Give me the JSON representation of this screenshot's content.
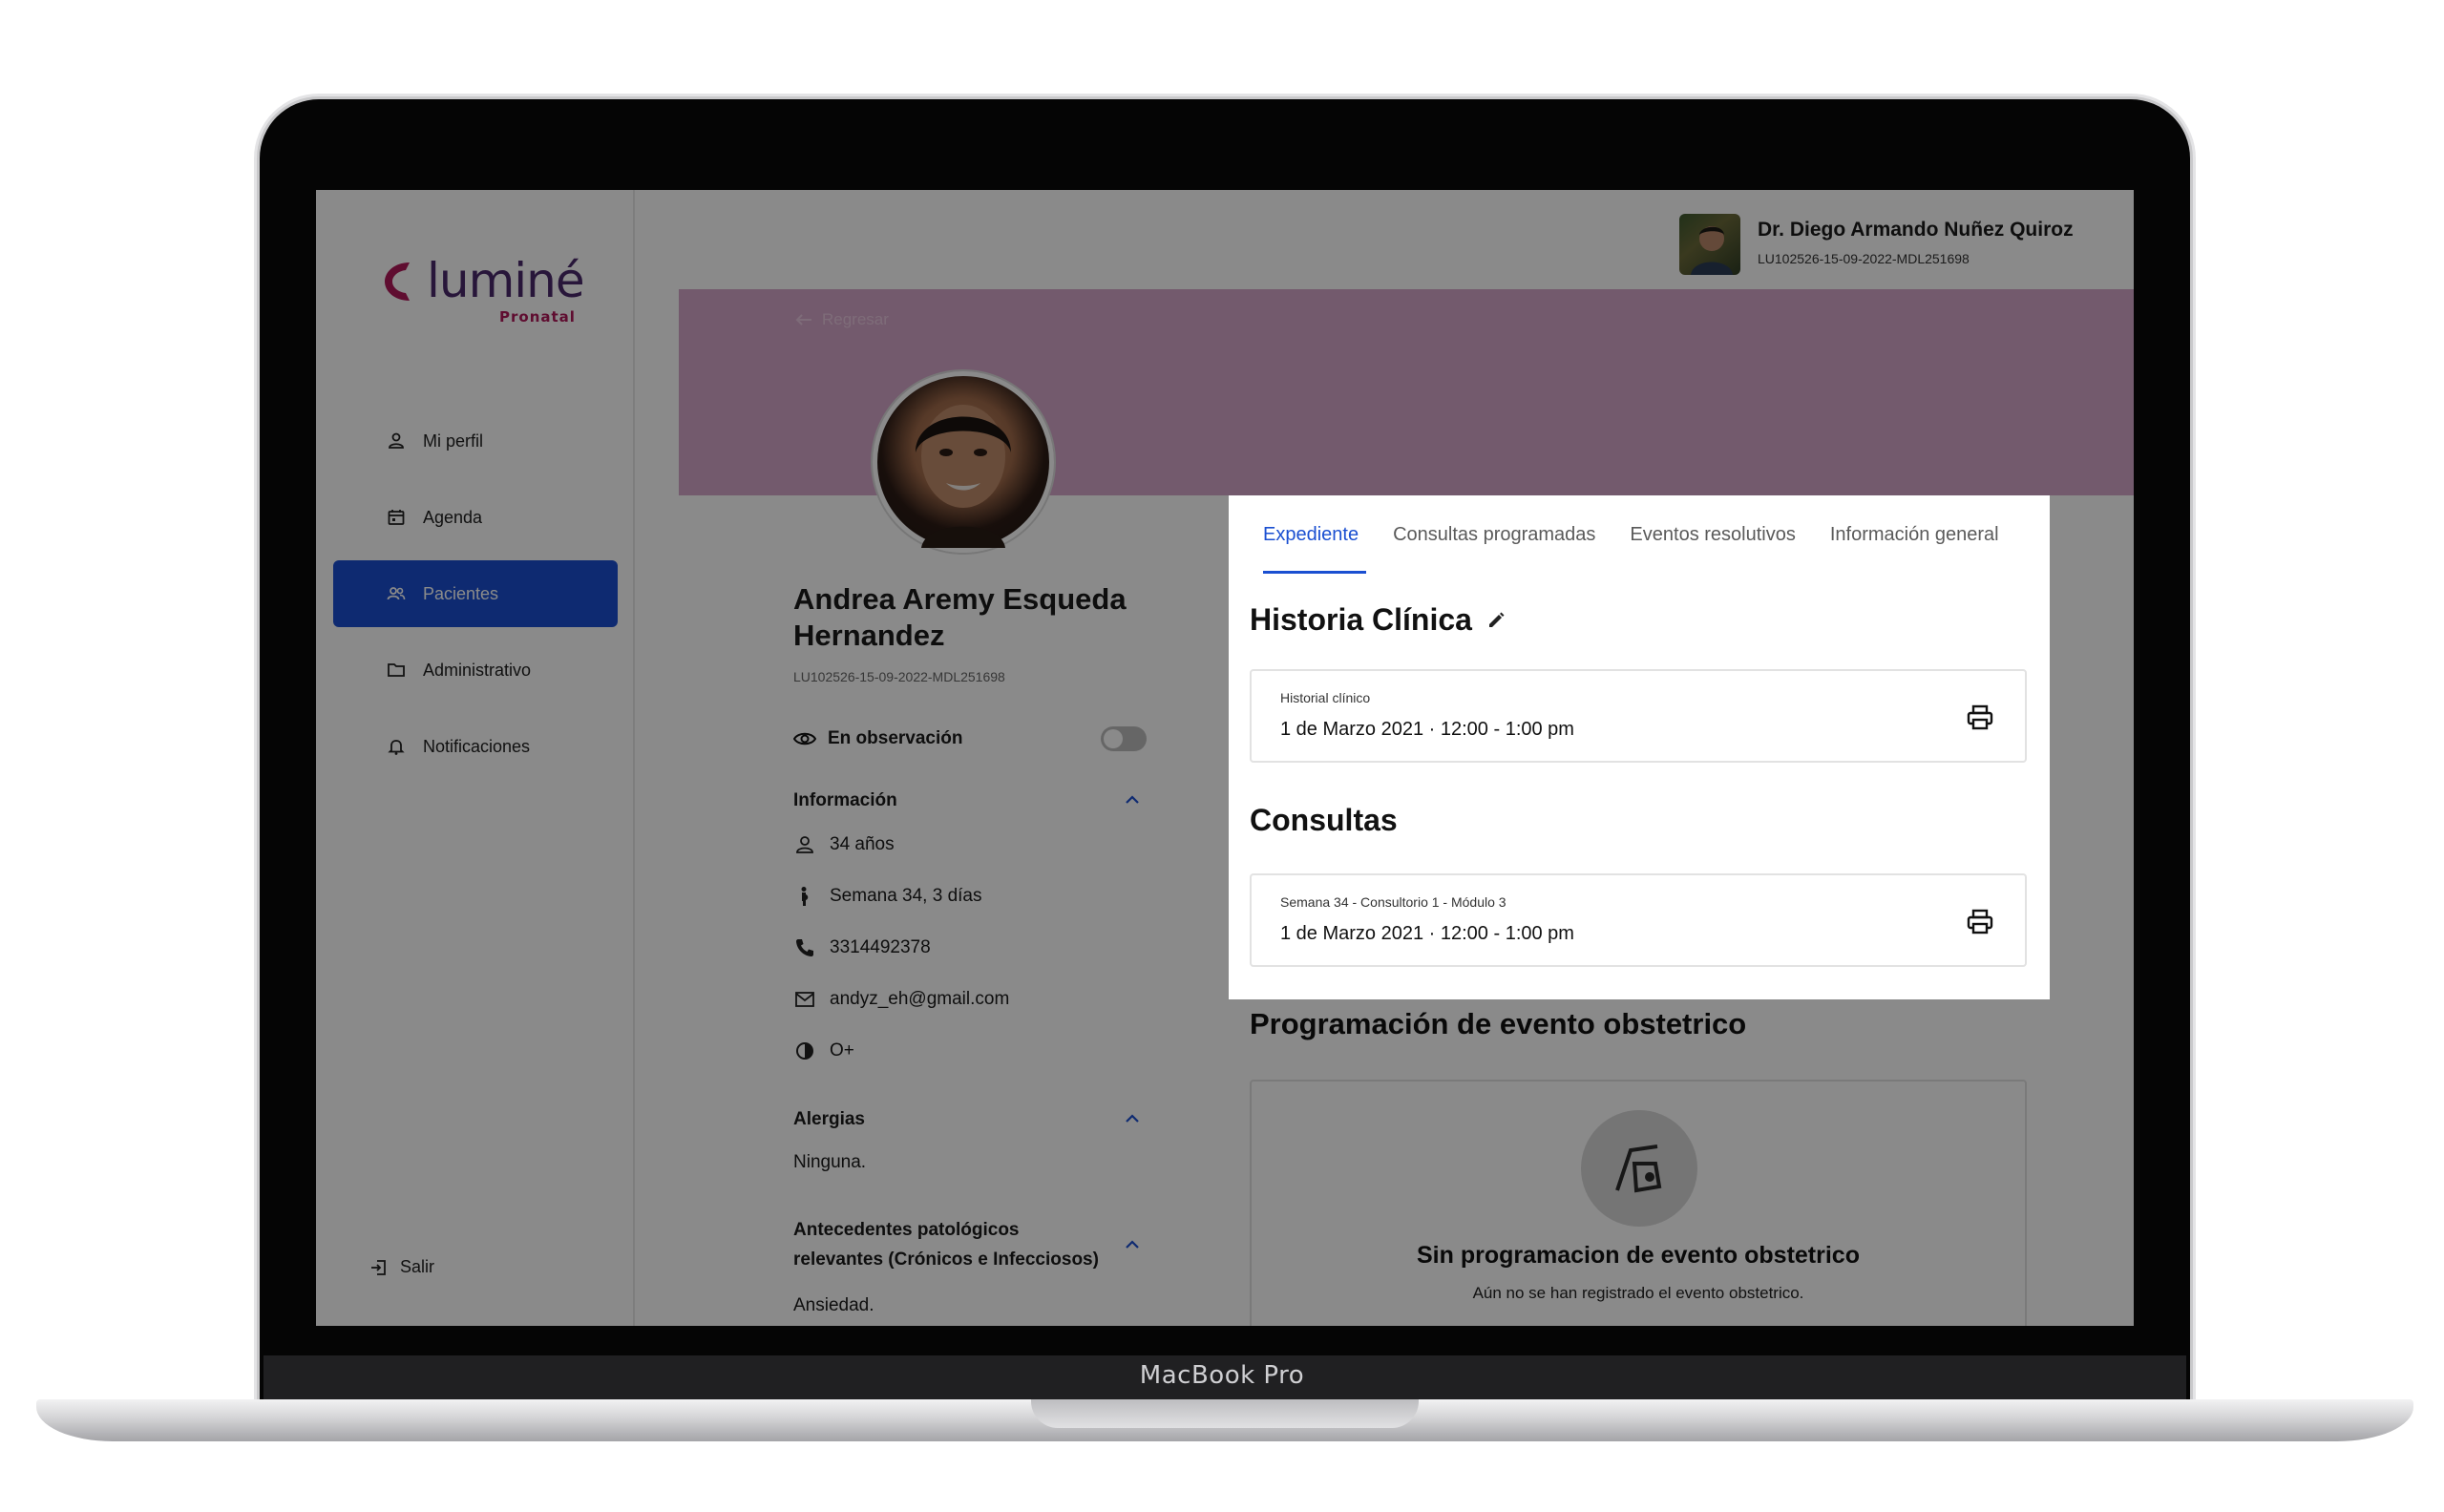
{
  "device": {
    "label": "MacBook Pro"
  },
  "brand": {
    "name": "luminé",
    "subtitle": "Pronatal"
  },
  "sidebar": {
    "items": [
      {
        "label": "Mi perfil",
        "icon": "user-icon"
      },
      {
        "label": "Agenda",
        "icon": "calendar-icon"
      },
      {
        "label": "Pacientes",
        "icon": "users-icon",
        "active": true
      },
      {
        "label": "Administrativo",
        "icon": "folder-icon"
      },
      {
        "label": "Notificaciones",
        "icon": "bell-icon"
      }
    ],
    "logout": "Salir"
  },
  "header": {
    "doctor_name": "Dr. Diego Armando Nuñez Quiroz",
    "doctor_id": "LU102526-15-09-2022-MDL251698"
  },
  "banner": {
    "back_label": "Regresar"
  },
  "patient": {
    "name": "Andrea Aremy Esqueda Hernandez",
    "id": "LU102526-15-09-2022-MDL251698",
    "observation_label": "En observación",
    "observation_on": false,
    "info_title": "Información",
    "age": "34 años",
    "week": "Semana 34, 3 días",
    "phone": "3314492378",
    "email": "andyz_eh@gmail.com",
    "blood": "O+",
    "allergies_title": "Alergias",
    "allergies": "Ninguna.",
    "antecedents_title": "Antecedentes patológicos relevantes (Crónicos e Infecciosos)",
    "antecedents": "Ansiedad."
  },
  "tabs": [
    {
      "label": "Expediente",
      "active": true
    },
    {
      "label": "Consultas programadas"
    },
    {
      "label": "Eventos resolutivos"
    },
    {
      "label": "Información general"
    }
  ],
  "historia": {
    "title": "Historia Clínica",
    "card_small": "Historial clínico",
    "card_main": "1 de Marzo 2021 · 12:00 - 1:00 pm"
  },
  "consultas": {
    "title": "Consultas",
    "card_small": "Semana 34 - Consultorio 1 - Módulo 3",
    "card_main": "1 de Marzo 2021 · 12:00 - 1:00 pm"
  },
  "programacion": {
    "title": "Programación de evento obstetrico",
    "empty_title": "Sin programacion de evento obstetrico",
    "empty_sub": "Aún no se han registrado el evento obstetrico."
  },
  "colors": {
    "accent": "#1a4fd1",
    "banner": "#d5a6c9",
    "brand": "#b0185a"
  }
}
